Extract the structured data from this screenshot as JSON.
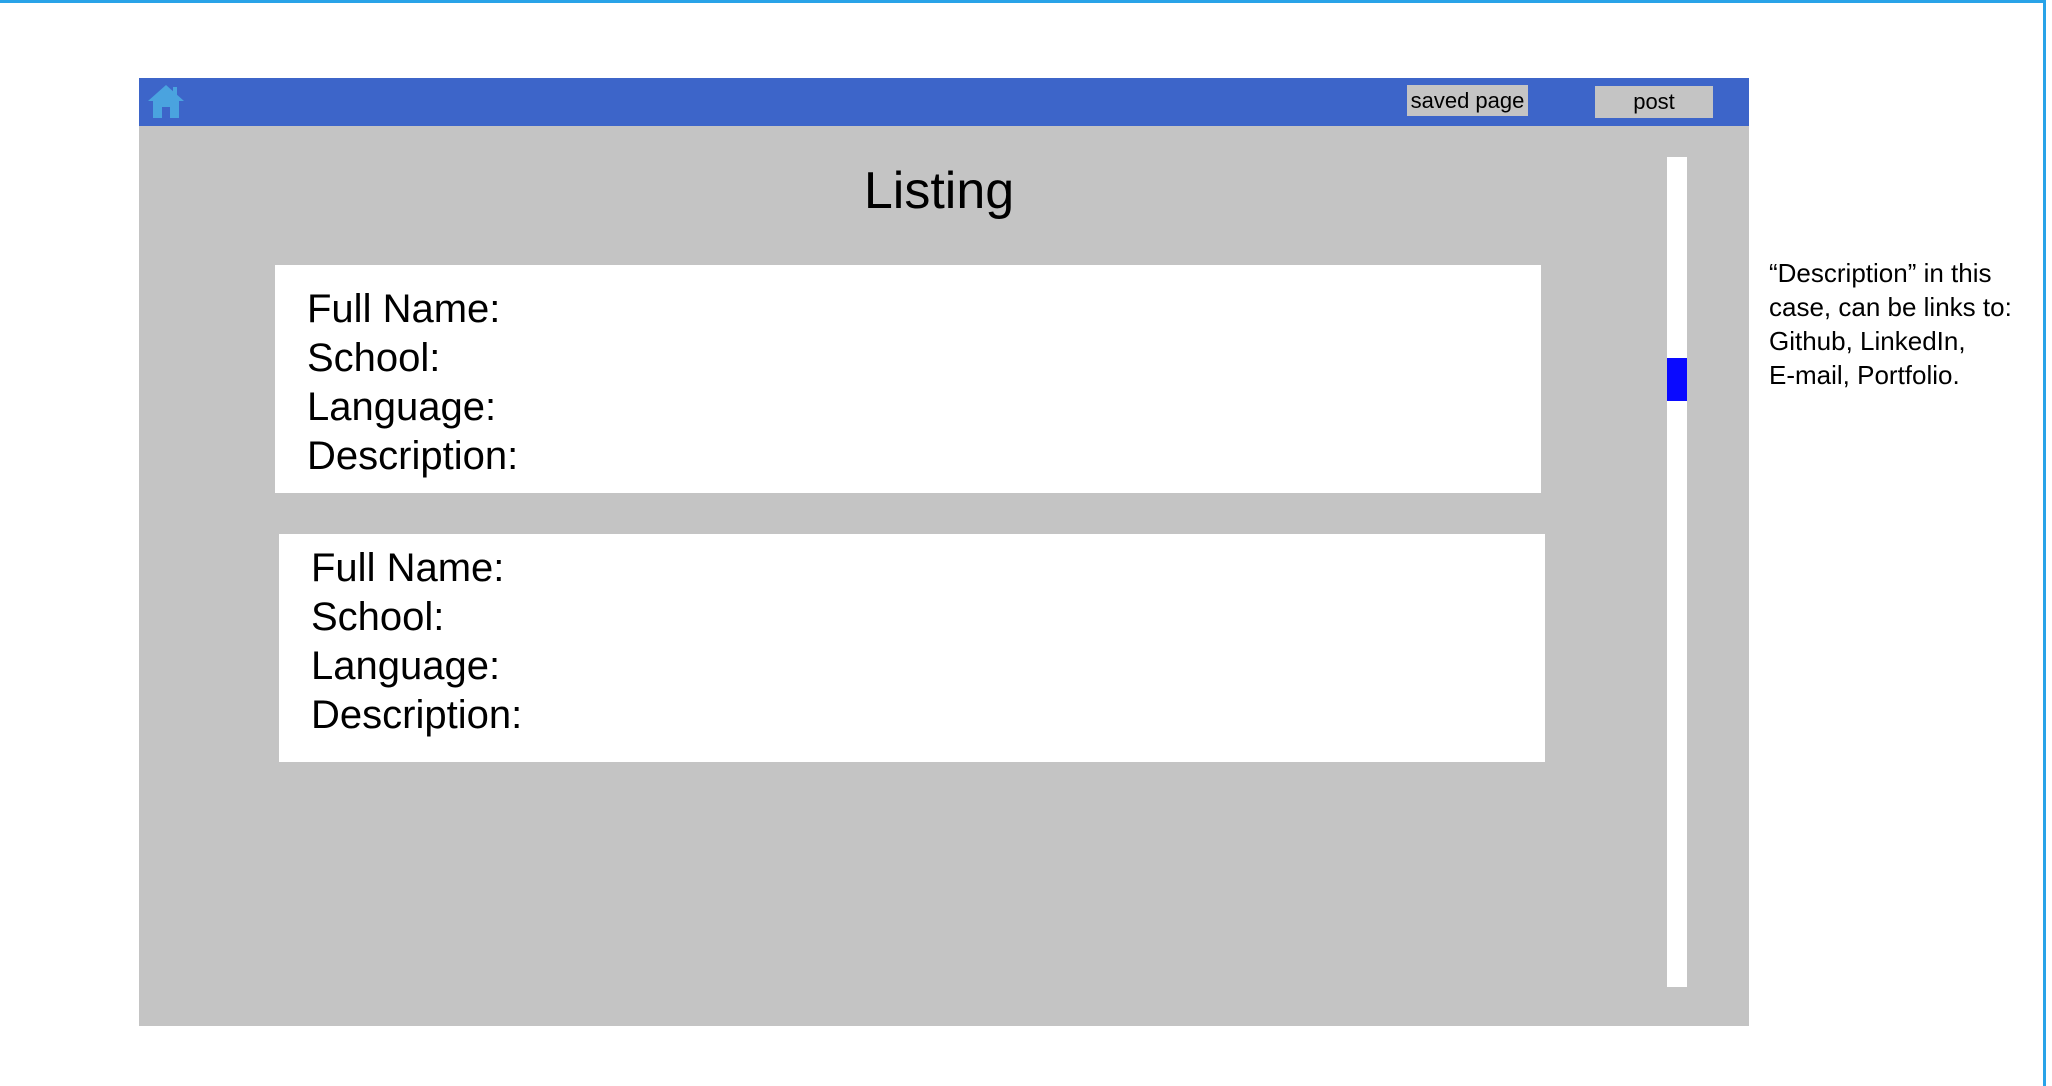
{
  "navbar": {
    "home_icon": "home-icon",
    "saved_page_label": "saved page",
    "post_label": "post",
    "color": "#3d65c9"
  },
  "main": {
    "title": "Listing",
    "listings": [
      {
        "full_name_label": "Full Name:",
        "school_label": "School:",
        "language_label": "Language:",
        "description_label": "Description:"
      },
      {
        "full_name_label": "Full Name:",
        "school_label": "School:",
        "language_label": "Language:",
        "description_label": "Description:"
      }
    ]
  },
  "scrollbar": {
    "thumb_color": "#0a0aff"
  },
  "annotation": {
    "lines": [
      "“Description” in this",
      "case, can be links to:",
      "Github, LinkedIn,",
      "E-mail, Portfolio."
    ]
  }
}
